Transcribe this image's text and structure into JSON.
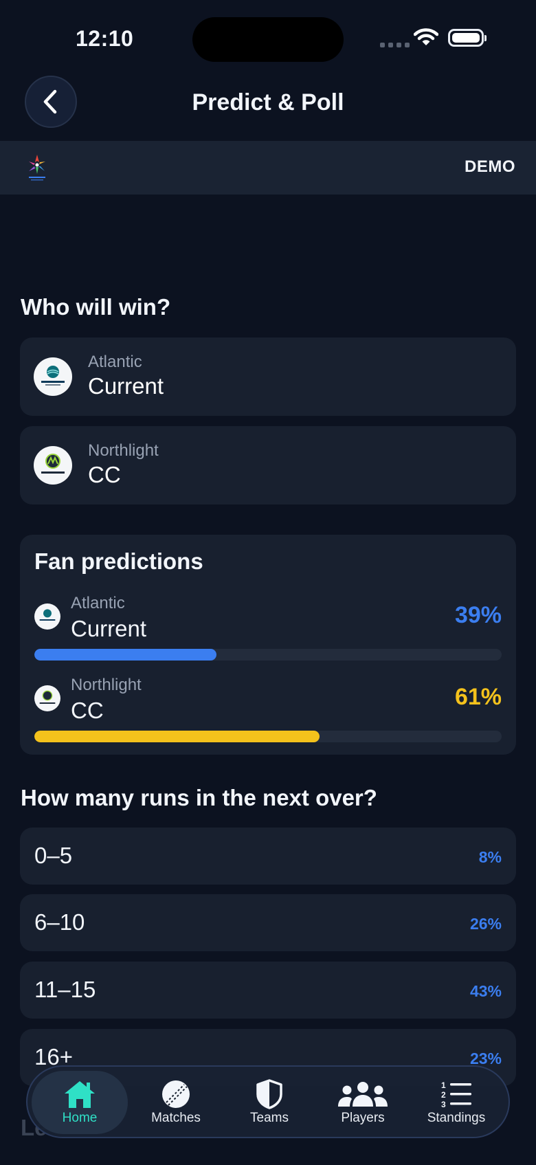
{
  "status": {
    "time": "12:10"
  },
  "header": {
    "title": "Predict & Poll"
  },
  "banner": {
    "badge": "DEMO"
  },
  "who_will_win": {
    "title": "Who will win?",
    "teams": [
      {
        "line1": "Atlantic",
        "line2": "Current"
      },
      {
        "line1": "Northlight",
        "line2": "CC"
      }
    ]
  },
  "fan_predictions": {
    "title": "Fan predictions",
    "rows": [
      {
        "line1": "Atlantic",
        "line2": "Current",
        "pct_label": "39%",
        "pct": 39,
        "color": "#3b7ef0"
      },
      {
        "line1": "Northlight",
        "line2": "CC",
        "pct_label": "61%",
        "pct": 61,
        "color": "#f4c21c"
      }
    ]
  },
  "runs_poll": {
    "title": "How many runs in the next over?",
    "options": [
      {
        "label": "0–5",
        "pct": "8%"
      },
      {
        "label": "6–10",
        "pct": "26%"
      },
      {
        "label": "11–15",
        "pct": "43%"
      },
      {
        "label": "16+",
        "pct": "23%"
      }
    ]
  },
  "obscured_section_title": "Le",
  "tabbar": {
    "tabs": [
      {
        "label": "Home",
        "icon": "home-icon",
        "active": true
      },
      {
        "label": "Matches",
        "icon": "cricket-ball-icon",
        "active": false
      },
      {
        "label": "Teams",
        "icon": "shield-icon",
        "active": false
      },
      {
        "label": "Players",
        "icon": "people-icon",
        "active": false
      },
      {
        "label": "Standings",
        "icon": "numbered-list-icon",
        "active": false
      }
    ]
  },
  "colors": {
    "accent_blue": "#3b7ef0",
    "accent_yellow": "#f4c21c",
    "active_tab": "#2fe0c6",
    "background": "#0c1220"
  }
}
